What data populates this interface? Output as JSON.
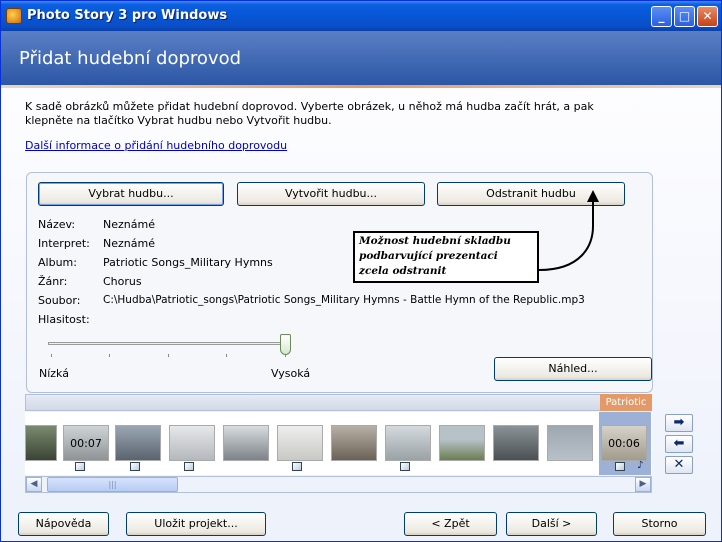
{
  "window": {
    "title": "Photo Story 3 pro Windows",
    "minimize": "_",
    "maximize": "□",
    "close": "✕"
  },
  "header": {
    "title": "Přidat hudební doprovod"
  },
  "description": "K sadě obrázků můžete přidat hudební doprovod. Vyberte obrázek, u něhož má hudba začít hrát, a pak klepněte na tlačítko Vybrat hudbu nebo Vytvořit hudbu.",
  "info_link": "Další informace o přidání hudebního doprovodu",
  "buttons": {
    "select": "Vybrat hudbu...",
    "create": "Vytvořit hudbu...",
    "remove": "Odstranit hudbu",
    "preview": "Náhled..."
  },
  "meta": [
    {
      "label": "Název:",
      "value": "Neznámé"
    },
    {
      "label": "Interpret:",
      "value": "Neznámé"
    },
    {
      "label": "Album:",
      "value": "Patriotic Songs_Military Hymns"
    },
    {
      "label": "Žánr:",
      "value": "Chorus"
    },
    {
      "label": "Soubor:",
      "value": "C:\\Hudba\\Patriotic_songs\\Patriotic Songs_Military Hymns - Battle Hymn of the Republic.mp3"
    }
  ],
  "volume": {
    "label": "Hlasitost:",
    "low": "Nízká",
    "high": "Vysoká",
    "level": 0.98
  },
  "callout": {
    "text1": "Možnost hudební skladbu",
    "text2": "podbarvující prezentaci",
    "text3": "zcela odstranit"
  },
  "filmstrip": {
    "music_label": "Patriotic",
    "time_first": "00:07",
    "time_last": "00:06"
  },
  "side_buttons": {
    "right": "➡",
    "left": "⬅",
    "delete": "✕"
  },
  "scrollbar": {
    "left": "◀",
    "right": "▶",
    "grip": "|||"
  },
  "footer": {
    "help": "Nápověda",
    "save": "Uložit projekt...",
    "back": "< Zpět",
    "next": "Další >",
    "cancel": "Storno"
  }
}
